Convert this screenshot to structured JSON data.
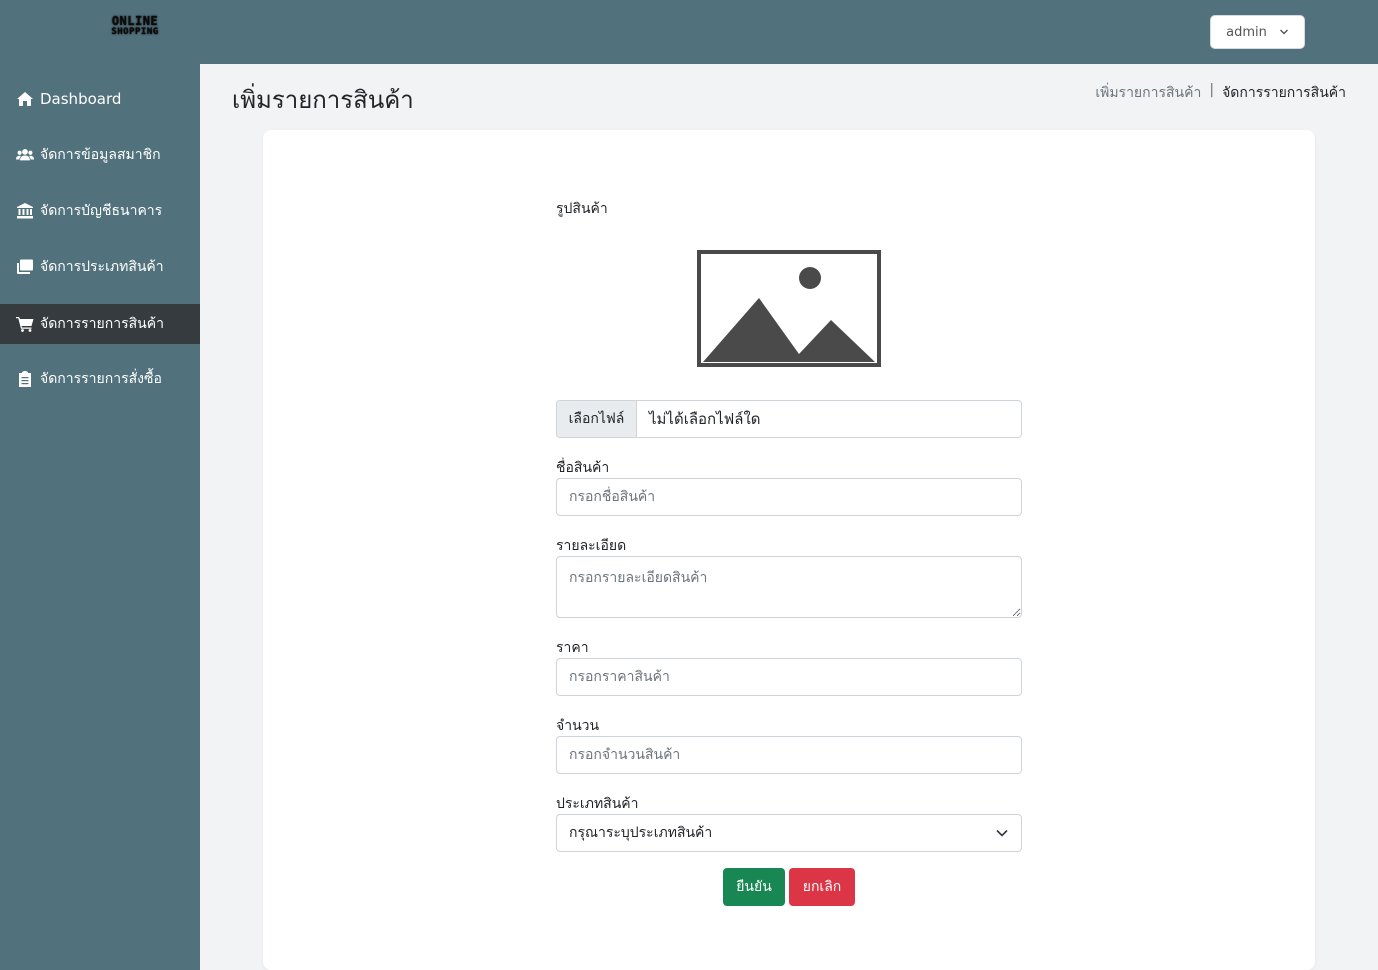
{
  "header": {
    "logo_line1": "ONLINE",
    "logo_line2": "SHOPPING",
    "user_menu": "admin"
  },
  "sidebar": {
    "items": [
      {
        "label": "Dashboard",
        "icon": "home-icon",
        "active": false
      },
      {
        "label": "จัดการข้อมูลสมาชิก",
        "icon": "users-icon",
        "active": false
      },
      {
        "label": "จัดการบัญชีธนาคาร",
        "icon": "bank-icon",
        "active": false
      },
      {
        "label": "จัดการประเภทสินค้า",
        "icon": "layers-icon",
        "active": false
      },
      {
        "label": "จัดการรายการสินค้า",
        "icon": "cart-icon",
        "active": true
      },
      {
        "label": "จัดการรายการสั่งซื้อ",
        "icon": "clipboard-icon",
        "active": false
      }
    ]
  },
  "page": {
    "title": "เพิ่มรายการสินค้า",
    "breadcrumb": [
      "เพิ่มรายการสินค้า",
      "จัดการรายการสินค้า"
    ]
  },
  "form": {
    "image_label": "รูปสินค้า",
    "image_icon": "image-placeholder-icon",
    "file_button": "เลือกไฟล์",
    "file_status": "ไม่ได้เลือกไฟล์ใด",
    "name_label": "ชื่อสินค้า",
    "name_placeholder": "กรอกชื่อสินค้า",
    "detail_label": "รายละเอียด",
    "detail_placeholder": "กรอกรายละเอียดสินค้า",
    "price_label": "ราคา",
    "price_placeholder": "กรอกราคาสินค้า",
    "qty_label": "จำนวน",
    "qty_placeholder": "กรอกจำนวนสินค้า",
    "type_label": "ประเภทสินค้า",
    "type_selected": "กรุณาระบุประเภทสินค้า",
    "submit": "ยืนยัน",
    "cancel": "ยกเลิก"
  },
  "colors": {
    "sidebar_bg": "#51717c",
    "active_item": "#363b3f",
    "success": "#198754",
    "danger": "#dc3545"
  }
}
